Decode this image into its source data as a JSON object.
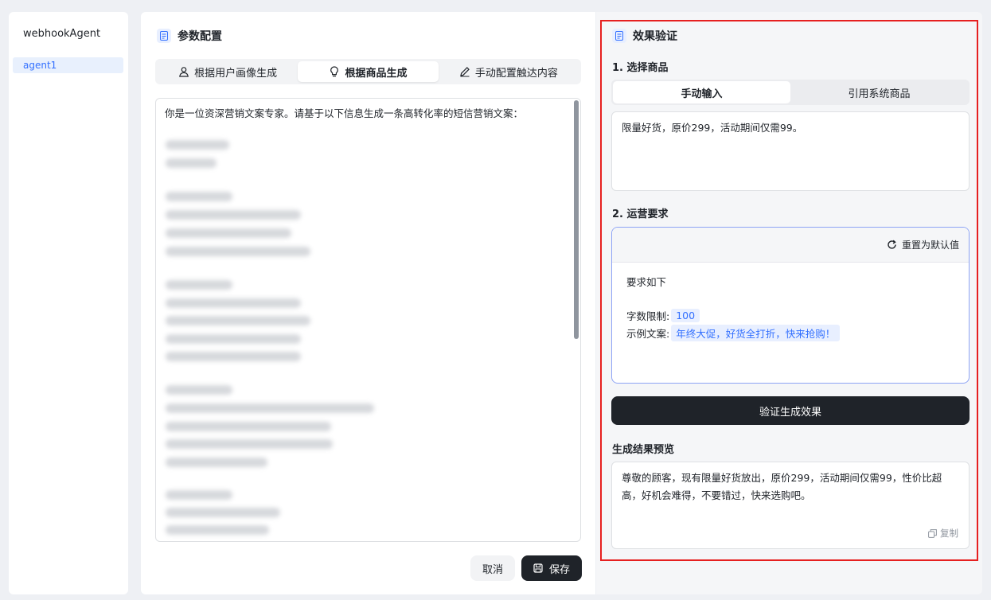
{
  "sidebar": {
    "app_title": "webhookAgent",
    "items": [
      {
        "label": "agent1",
        "selected": true
      }
    ]
  },
  "config": {
    "title": "参数配置",
    "tabs": [
      {
        "label": "根据用户画像生成",
        "icon": "user-icon",
        "active": false
      },
      {
        "label": "根据商品生成",
        "icon": "lightbulb-icon",
        "active": true
      },
      {
        "label": "手动配置触达内容",
        "icon": "pencil-icon",
        "active": false
      }
    ],
    "prompt_first_line": "你是一位资深营销文案专家。请基于以下信息生成一条高转化率的短信营销文案：",
    "cancel_label": "取消",
    "save_label": "保存"
  },
  "verify": {
    "title": "效果验证",
    "step1_label": "1. 选择商品",
    "product_tabs": [
      {
        "label": "手动输入",
        "active": true
      },
      {
        "label": "引用系统商品",
        "active": false
      }
    ],
    "product_input_value": "限量好货，原价299，活动期间仅需99。",
    "step2_label": "2. 运营要求",
    "reset_label": "重置为默认值",
    "requirements_intro": "要求如下",
    "word_limit_label": "字数限制:",
    "word_limit_value": "100",
    "example_label": "示例文案:",
    "example_value": "年终大促，好货全打折，快来抢购！",
    "verify_button_label": "验证生成效果",
    "result_label": "生成结果预览",
    "result_text": "尊敬的顾客，现有限量好货放出，原价299，活动期间仅需99，性价比超高，好机会难得，不要错过，快来选购吧。",
    "copy_label": "复制"
  },
  "colors": {
    "accent": "#3370ff",
    "dark_button": "#1f2329",
    "highlight_frame": "#e62020"
  }
}
